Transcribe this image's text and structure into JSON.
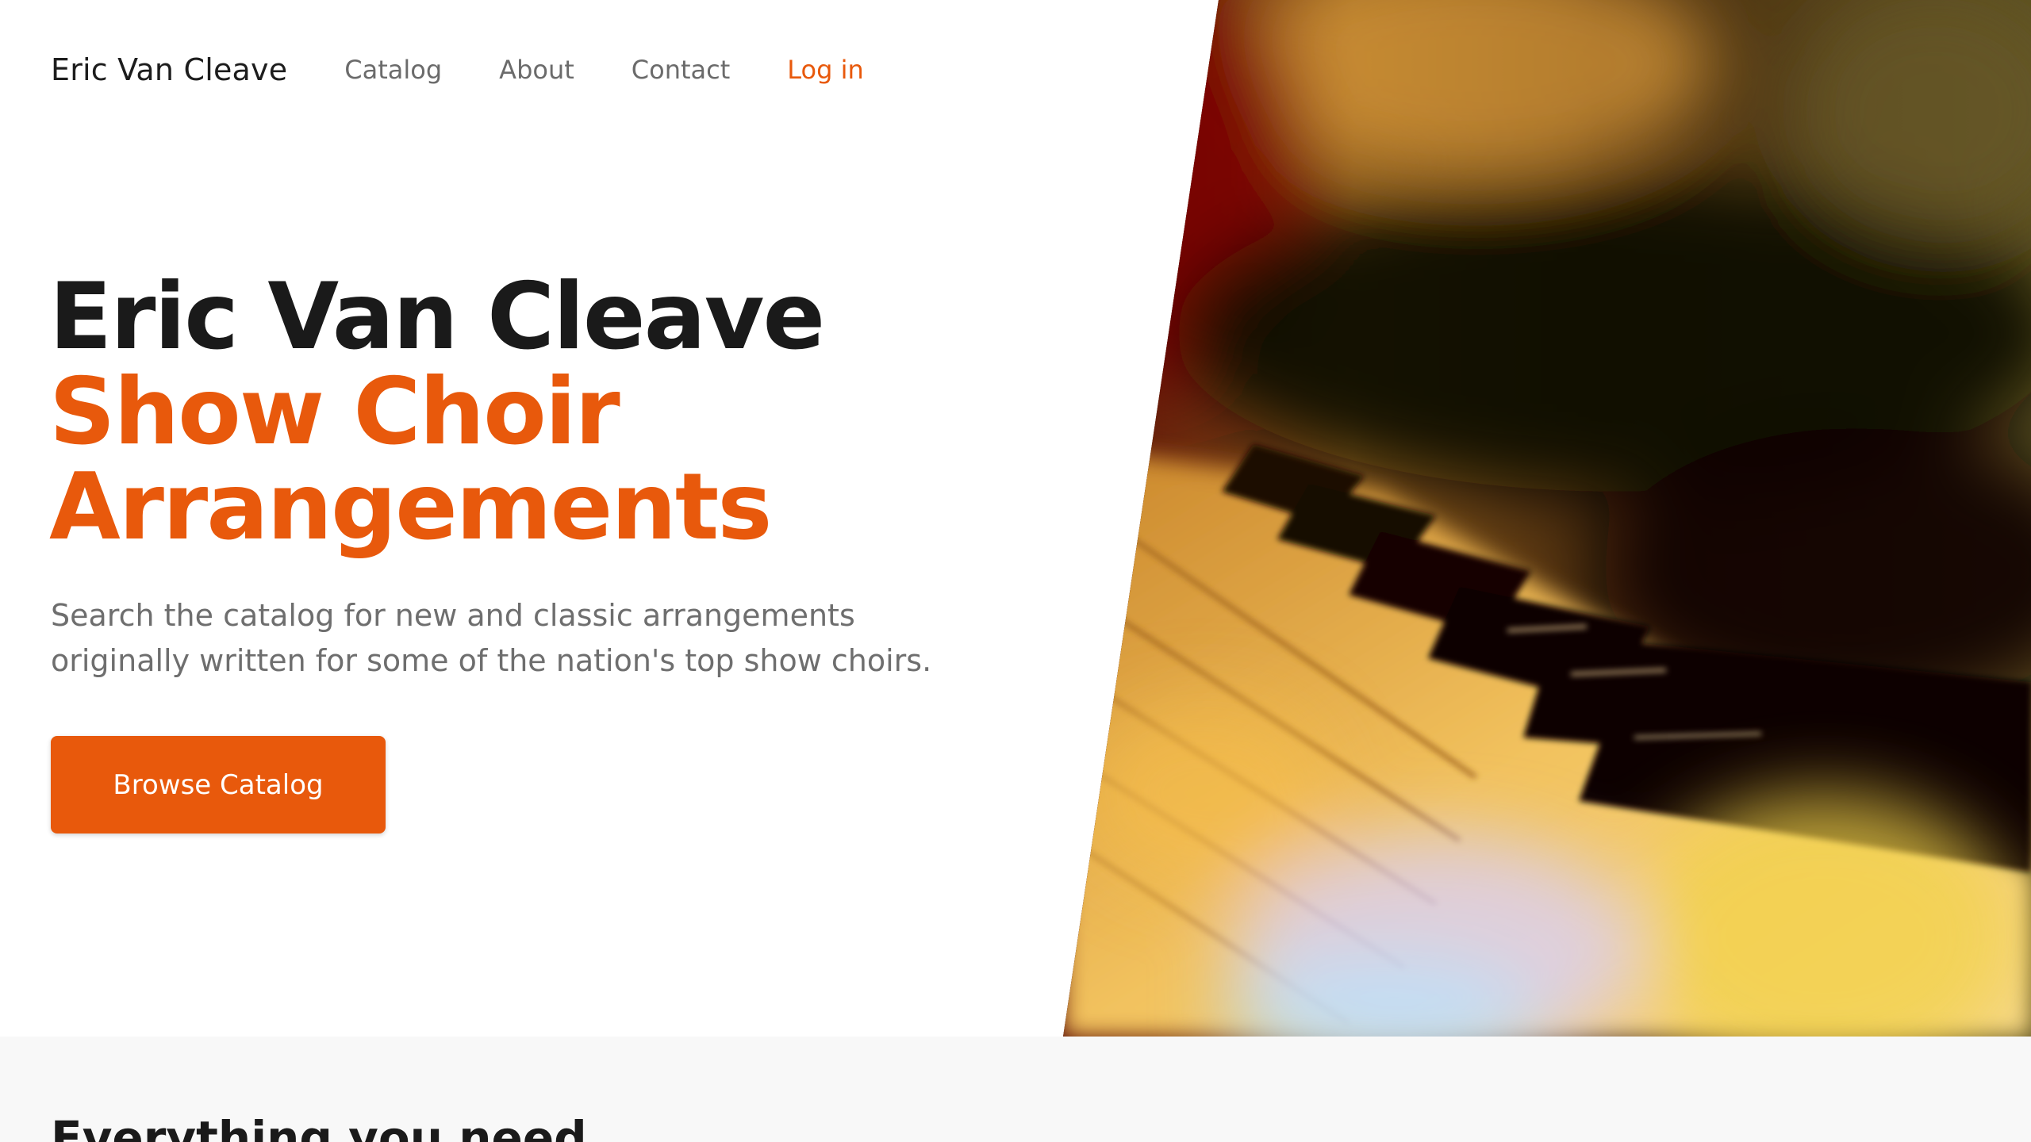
{
  "nav": {
    "brand": "Eric Van Cleave",
    "links": [
      {
        "label": "Catalog"
      },
      {
        "label": "About"
      },
      {
        "label": "Contact"
      }
    ],
    "login": "Log in"
  },
  "hero": {
    "title_line1": "Eric Van Cleave",
    "title_line2": "Show Choir",
    "title_line3": "Arrangements",
    "description": "Search the catalog for new and classic arrangements originally written for some of the nation's top show choirs.",
    "cta_label": "Browse Catalog",
    "image_subject": "piano keys close-up"
  },
  "features": {
    "heading": "Everything you need"
  },
  "colors": {
    "accent": "#e8590c",
    "text_dark": "#1a1a1a",
    "text_muted": "#6e6e6e",
    "section_bg": "#f8f8f8"
  }
}
